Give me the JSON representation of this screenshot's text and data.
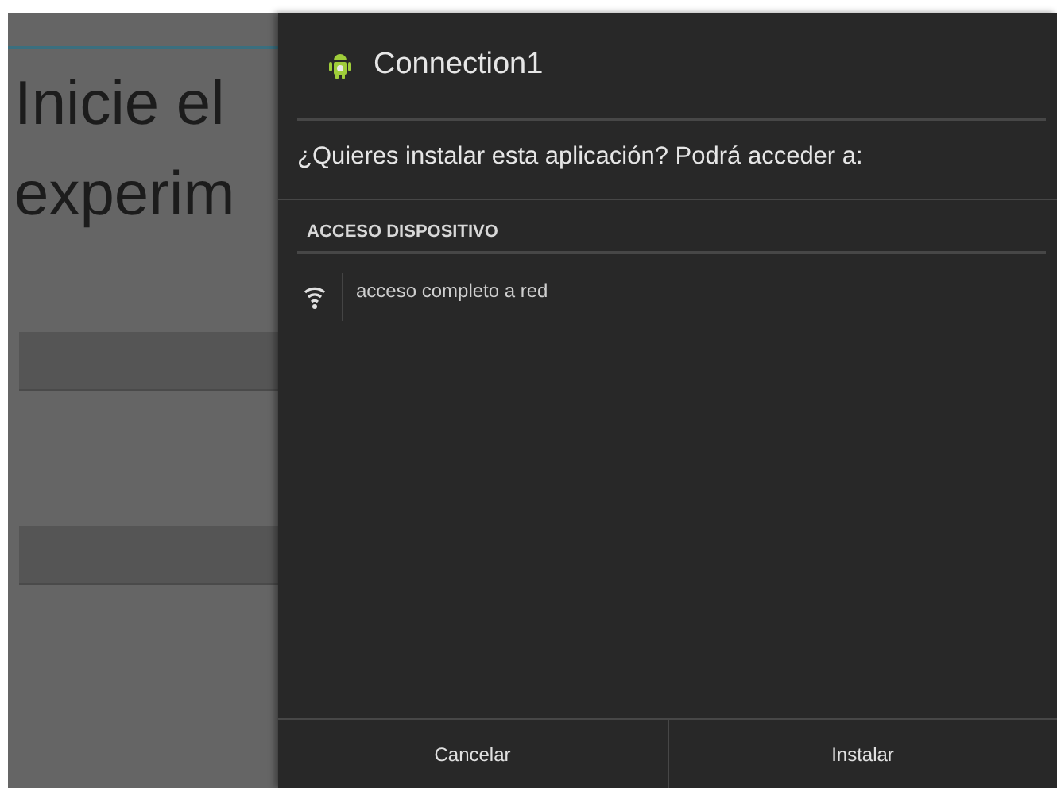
{
  "background": {
    "heading": [
      "Inicie el",
      "experim"
    ]
  },
  "dialog": {
    "title": "Connection1",
    "message": "¿Quieres instalar esta aplicación? Podrá acceder a:",
    "section": "ACCESO DISPOSITIVO",
    "permissions": [
      {
        "kind": "network",
        "label": "acceso completo a red"
      }
    ],
    "buttons": [
      "Cancelar",
      "Instalar"
    ]
  }
}
